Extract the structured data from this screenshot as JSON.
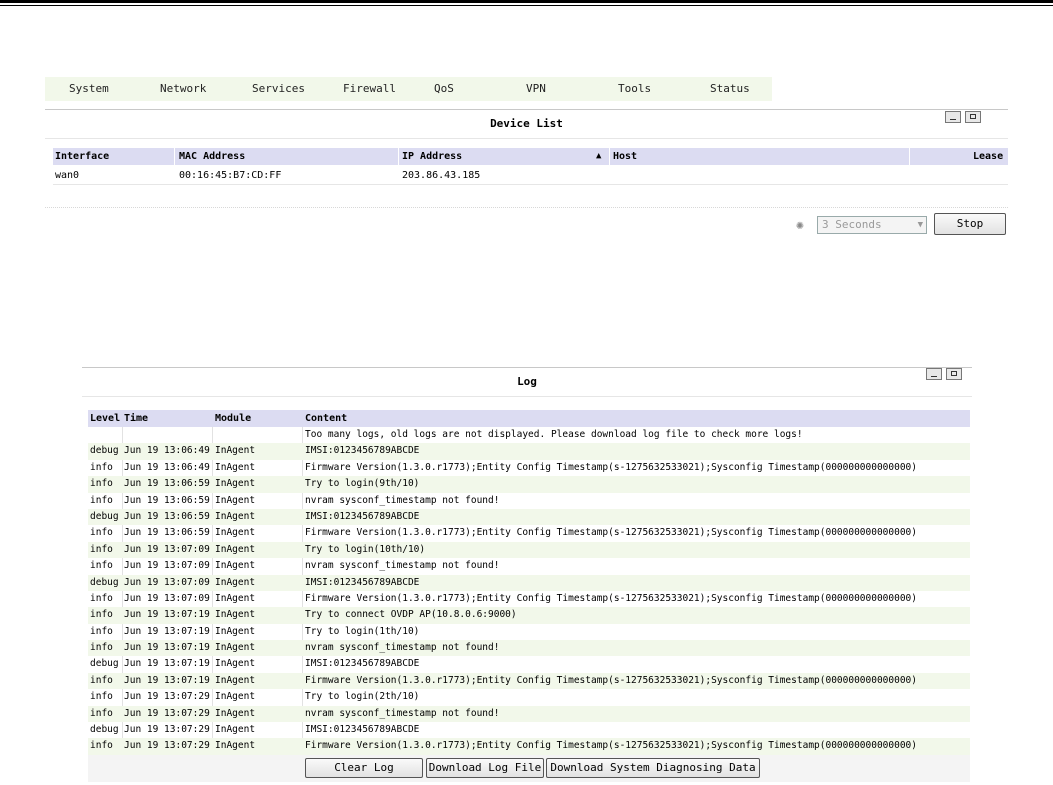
{
  "nav": {
    "items": [
      "System",
      "Network",
      "Services",
      "Firewall",
      "QoS",
      "VPN",
      "Tools",
      "Status"
    ]
  },
  "device_list": {
    "title": "Device List",
    "columns": [
      "Interface",
      "MAC Address",
      "IP Address",
      "Host",
      "Lease"
    ],
    "sort_indicator": "▲",
    "rows": [
      {
        "interface": "wan0",
        "mac": "00:16:45:B7:CD:FF",
        "ip": "203.86.43.185",
        "host": "",
        "lease": ""
      }
    ],
    "refresh_select": "3 Seconds",
    "stop_label": "Stop"
  },
  "log": {
    "title": "Log",
    "columns": [
      "Level",
      "Time",
      "Module",
      "Content"
    ],
    "notice": "Too many logs, old logs are not displayed. Please download log file to check more logs!",
    "rows": [
      {
        "level": "debug",
        "time": "Jun 19 13:06:49",
        "module": "InAgent",
        "content": "IMSI:0123456789ABCDE"
      },
      {
        "level": "info",
        "time": "Jun 19 13:06:49",
        "module": "InAgent",
        "content": "Firmware Version(1.3.0.r1773);Entity Config Timestamp(s-1275632533021);Sysconfig Timestamp(000000000000000)"
      },
      {
        "level": "info",
        "time": "Jun 19 13:06:59",
        "module": "InAgent",
        "content": "Try to login(9th/10)"
      },
      {
        "level": "info",
        "time": "Jun 19 13:06:59",
        "module": "InAgent",
        "content": "nvram sysconf_timestamp not found!"
      },
      {
        "level": "debug",
        "time": "Jun 19 13:06:59",
        "module": "InAgent",
        "content": "IMSI:0123456789ABCDE"
      },
      {
        "level": "info",
        "time": "Jun 19 13:06:59",
        "module": "InAgent",
        "content": "Firmware Version(1.3.0.r1773);Entity Config Timestamp(s-1275632533021);Sysconfig Timestamp(000000000000000)"
      },
      {
        "level": "info",
        "time": "Jun 19 13:07:09",
        "module": "InAgent",
        "content": "Try to login(10th/10)"
      },
      {
        "level": "info",
        "time": "Jun 19 13:07:09",
        "module": "InAgent",
        "content": "nvram sysconf_timestamp not found!"
      },
      {
        "level": "debug",
        "time": "Jun 19 13:07:09",
        "module": "InAgent",
        "content": "IMSI:0123456789ABCDE"
      },
      {
        "level": "info",
        "time": "Jun 19 13:07:09",
        "module": "InAgent",
        "content": "Firmware Version(1.3.0.r1773);Entity Config Timestamp(s-1275632533021);Sysconfig Timestamp(000000000000000)"
      },
      {
        "level": "info",
        "time": "Jun 19 13:07:19",
        "module": "InAgent",
        "content": "Try to connect OVDP AP(10.8.0.6:9000)"
      },
      {
        "level": "info",
        "time": "Jun 19 13:07:19",
        "module": "InAgent",
        "content": "Try to login(1th/10)"
      },
      {
        "level": "info",
        "time": "Jun 19 13:07:19",
        "module": "InAgent",
        "content": "nvram sysconf_timestamp not found!"
      },
      {
        "level": "debug",
        "time": "Jun 19 13:07:19",
        "module": "InAgent",
        "content": "IMSI:0123456789ABCDE"
      },
      {
        "level": "info",
        "time": "Jun 19 13:07:19",
        "module": "InAgent",
        "content": "Firmware Version(1.3.0.r1773);Entity Config Timestamp(s-1275632533021);Sysconfig Timestamp(000000000000000)"
      },
      {
        "level": "info",
        "time": "Jun 19 13:07:29",
        "module": "InAgent",
        "content": "Try to login(2th/10)"
      },
      {
        "level": "info",
        "time": "Jun 19 13:07:29",
        "module": "InAgent",
        "content": "nvram sysconf_timestamp not found!"
      },
      {
        "level": "debug",
        "time": "Jun 19 13:07:29",
        "module": "InAgent",
        "content": "IMSI:0123456789ABCDE"
      },
      {
        "level": "info",
        "time": "Jun 19 13:07:29",
        "module": "InAgent",
        "content": "Firmware Version(1.3.0.r1773);Entity Config Timestamp(s-1275632533021);Sysconfig Timestamp(000000000000000)"
      }
    ],
    "buttons": {
      "clear": "Clear Log",
      "download_log": "Download Log File",
      "download_diag": "Download System Diagnosing Data"
    }
  }
}
